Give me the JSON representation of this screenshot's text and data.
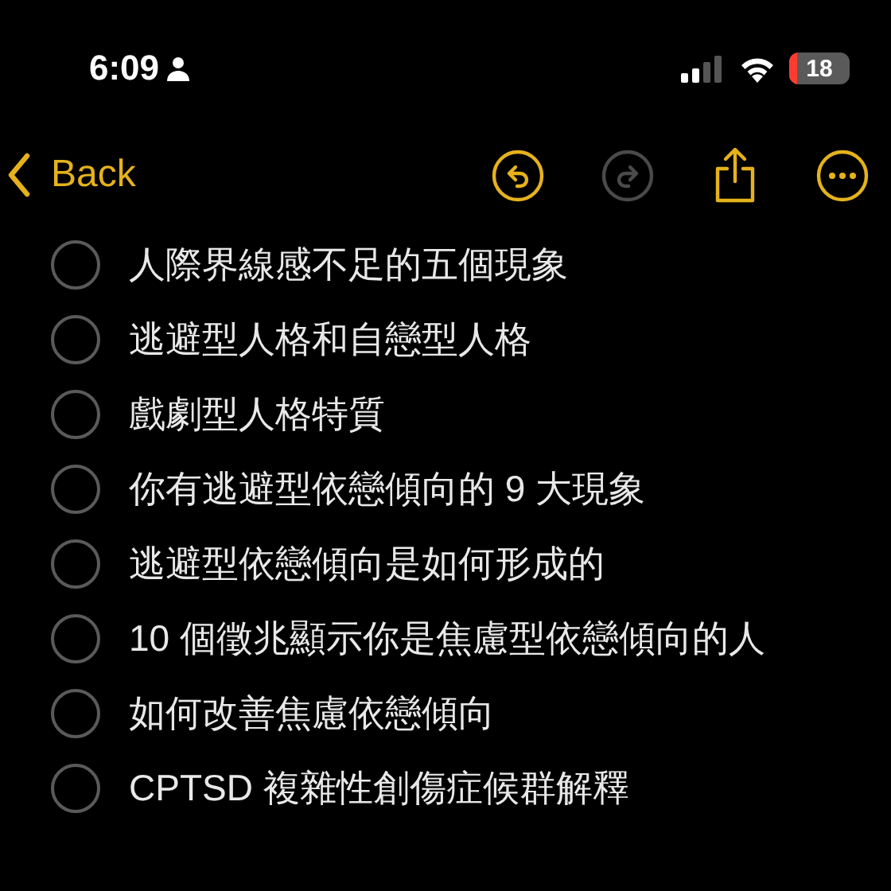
{
  "status_bar": {
    "time": "6:09",
    "battery": "18"
  },
  "toolbar": {
    "back": "Back",
    "undo": {
      "disabled": false
    },
    "redo": {
      "disabled": true
    }
  },
  "checklist": [
    {
      "text": "人際界線感不足的五個現象",
      "checked": false
    },
    {
      "text": "逃避型人格和自戀型人格",
      "checked": false
    },
    {
      "text": "戲劇型人格特質",
      "checked": false
    },
    {
      "text": "你有逃避型依戀傾向的 9 大現象",
      "checked": false
    },
    {
      "text": "逃避型依戀傾向是如何形成的",
      "checked": false
    },
    {
      "text": "10 個徵兆顯示你是焦慮型依戀傾向的人",
      "checked": false
    },
    {
      "text": "如何改善焦慮依戀傾向",
      "checked": false
    },
    {
      "text": "CPTSD 複雜性創傷症候群解釋",
      "checked": false
    }
  ]
}
